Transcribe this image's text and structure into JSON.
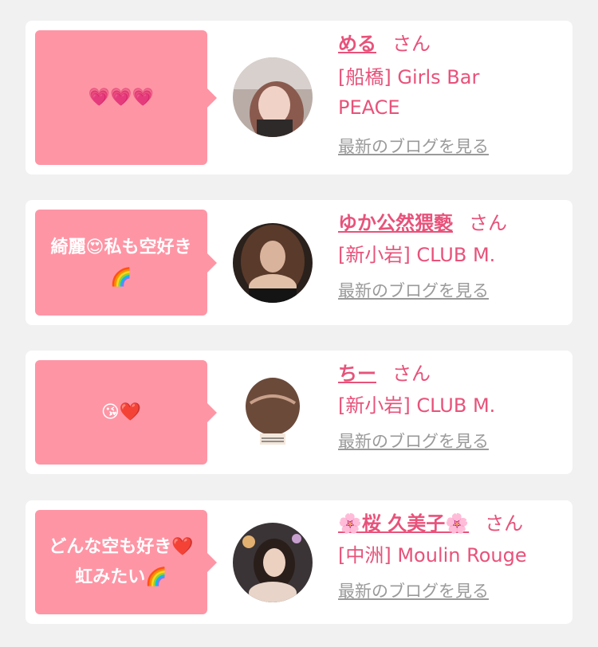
{
  "suffix": "さん",
  "blog_link_label": "最新のブログを見る",
  "colors": {
    "background": "#f1f1f1",
    "card": "#ffffff",
    "bubble": "#fe95a5",
    "accent": "#e8527a",
    "link_gray": "#9a9a9a"
  },
  "entries": [
    {
      "message": "💗💗💗",
      "name": "める",
      "shop": "[船橋] Girls Bar PEACE"
    },
    {
      "message": "綺麗😍私も空好き🌈",
      "name": "ゆか公然猥褻",
      "shop": "[新小岩] CLUB M."
    },
    {
      "message": "😘❤️",
      "name": "ちー",
      "shop": "[新小岩] CLUB M."
    },
    {
      "message": "どんな空も好き❤️虹みたい🌈",
      "name": "🌸桜 久美子🌸",
      "shop": "[中洲] Moulin Rouge"
    }
  ]
}
